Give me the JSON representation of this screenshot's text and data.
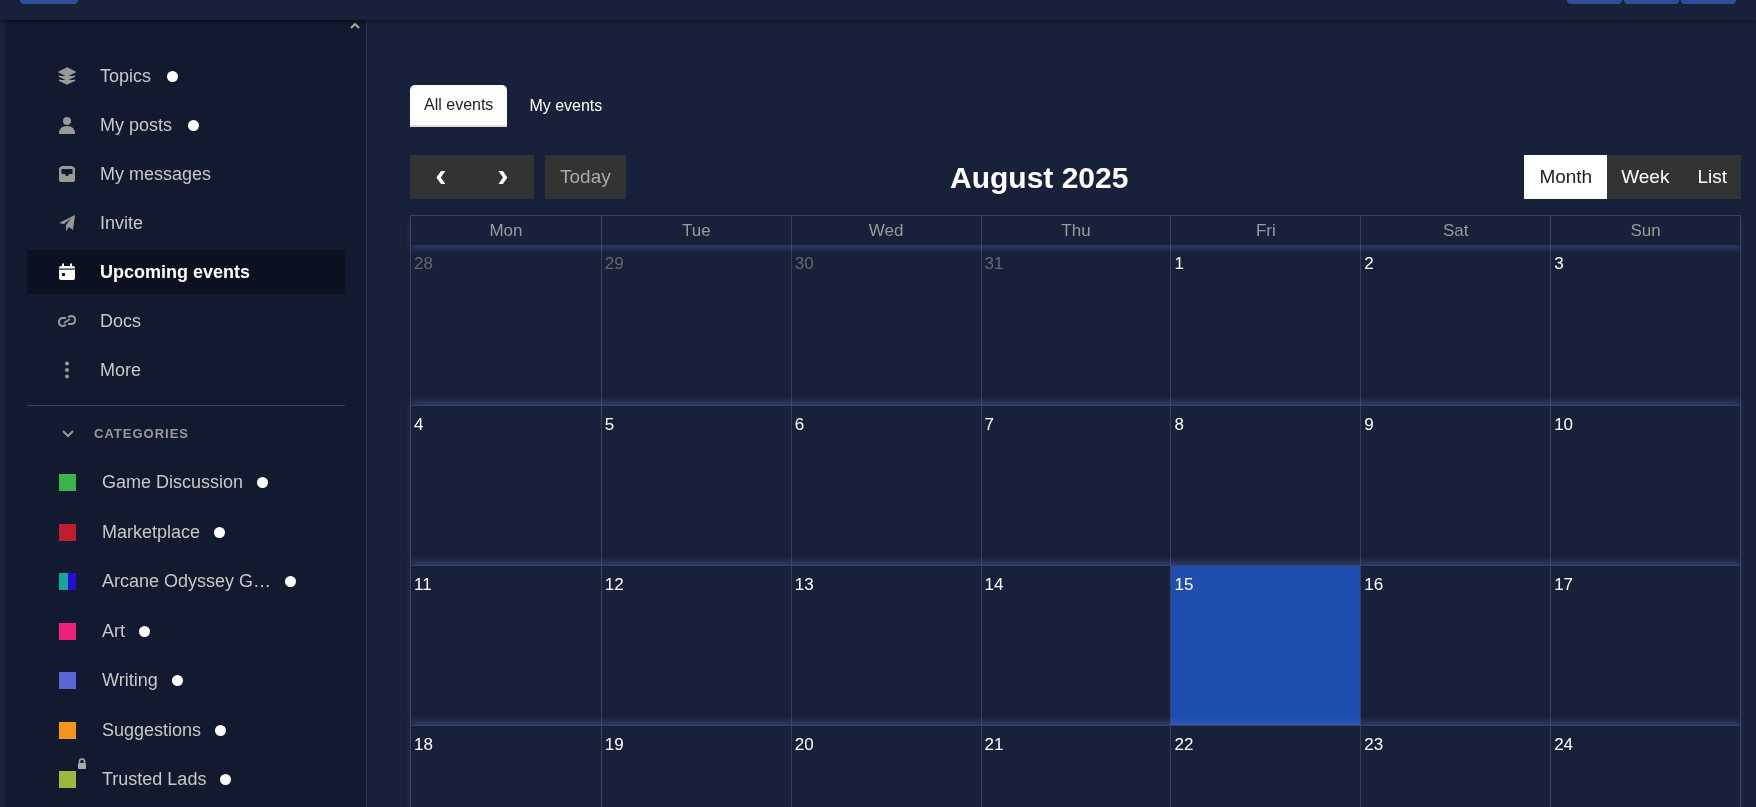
{
  "nav": [
    {
      "label": "Topics",
      "kind": "layers",
      "unread": true,
      "selected": false
    },
    {
      "label": "My posts",
      "kind": "user",
      "unread": true,
      "selected": false
    },
    {
      "label": "My messages",
      "kind": "inbox",
      "unread": false,
      "selected": false
    },
    {
      "label": "Invite",
      "kind": "plane",
      "unread": false,
      "selected": false
    },
    {
      "label": "Upcoming events",
      "kind": "calendar",
      "unread": false,
      "selected": true
    },
    {
      "label": "Docs",
      "kind": "link",
      "unread": false,
      "selected": false
    },
    {
      "label": "More",
      "kind": "dots",
      "unread": false,
      "selected": false
    }
  ],
  "categories": {
    "heading": "CATEGORIES",
    "expanded": true,
    "items": [
      {
        "label": "Game Discussion",
        "swatch": [
          {
            "color": "#3ab54a"
          }
        ],
        "unread": true,
        "locked": false
      },
      {
        "label": "Marketplace",
        "swatch": [
          {
            "color": "#bf1e2e"
          }
        ],
        "unread": true,
        "locked": false
      },
      {
        "label": "Arcane Odyssey G…",
        "swatch": [
          {
            "color": "#12a89d"
          },
          {
            "color": "#2c0adb"
          }
        ],
        "unread": true,
        "locked": false
      },
      {
        "label": "Art",
        "swatch": [
          {
            "color": "#ed207b"
          }
        ],
        "unread": true,
        "locked": false
      },
      {
        "label": "Writing",
        "swatch": [
          {
            "color": "#5867d4"
          }
        ],
        "unread": true,
        "locked": false
      },
      {
        "label": "Suggestions",
        "swatch": [
          {
            "color": "#f7941d"
          }
        ],
        "unread": true,
        "locked": false
      },
      {
        "label": "Trusted Lads",
        "swatch": [
          {
            "color": "#9eb83b"
          }
        ],
        "unread": true,
        "locked": true
      }
    ]
  },
  "tabs": [
    {
      "label": "All events",
      "selected": true
    },
    {
      "label": "My events",
      "selected": false
    }
  ],
  "toolbar": {
    "prev": "‹",
    "next": "›",
    "today": "Today",
    "title": "August 2025",
    "views": [
      {
        "label": "Month",
        "selected": true
      },
      {
        "label": "Week",
        "selected": false
      },
      {
        "label": "List",
        "selected": false
      }
    ]
  },
  "calendar": {
    "weekdays": [
      "Mon",
      "Tue",
      "Wed",
      "Thu",
      "Fri",
      "Sat",
      "Sun"
    ],
    "weeks": [
      [
        {
          "day": "28",
          "outside": true,
          "today": false
        },
        {
          "day": "29",
          "outside": true,
          "today": false
        },
        {
          "day": "30",
          "outside": true,
          "today": false
        },
        {
          "day": "31",
          "outside": true,
          "today": false
        },
        {
          "day": "1",
          "outside": false,
          "today": false
        },
        {
          "day": "2",
          "outside": false,
          "today": false
        },
        {
          "day": "3",
          "outside": false,
          "today": false
        }
      ],
      [
        {
          "day": "4",
          "outside": false,
          "today": false
        },
        {
          "day": "5",
          "outside": false,
          "today": false
        },
        {
          "day": "6",
          "outside": false,
          "today": false
        },
        {
          "day": "7",
          "outside": false,
          "today": false
        },
        {
          "day": "8",
          "outside": false,
          "today": false
        },
        {
          "day": "9",
          "outside": false,
          "today": false
        },
        {
          "day": "10",
          "outside": false,
          "today": false
        }
      ],
      [
        {
          "day": "11",
          "outside": false,
          "today": false
        },
        {
          "day": "12",
          "outside": false,
          "today": false
        },
        {
          "day": "13",
          "outside": false,
          "today": false
        },
        {
          "day": "14",
          "outside": false,
          "today": false
        },
        {
          "day": "15",
          "outside": false,
          "today": true
        },
        {
          "day": "16",
          "outside": false,
          "today": false
        },
        {
          "day": "17",
          "outside": false,
          "today": false
        }
      ],
      [
        {
          "day": "18",
          "outside": false,
          "today": false
        },
        {
          "day": "19",
          "outside": false,
          "today": false
        },
        {
          "day": "20",
          "outside": false,
          "today": false
        },
        {
          "day": "21",
          "outside": false,
          "today": false
        },
        {
          "day": "22",
          "outside": false,
          "today": false
        },
        {
          "day": "23",
          "outside": false,
          "today": false
        },
        {
          "day": "24",
          "outside": false,
          "today": false
        }
      ]
    ]
  }
}
